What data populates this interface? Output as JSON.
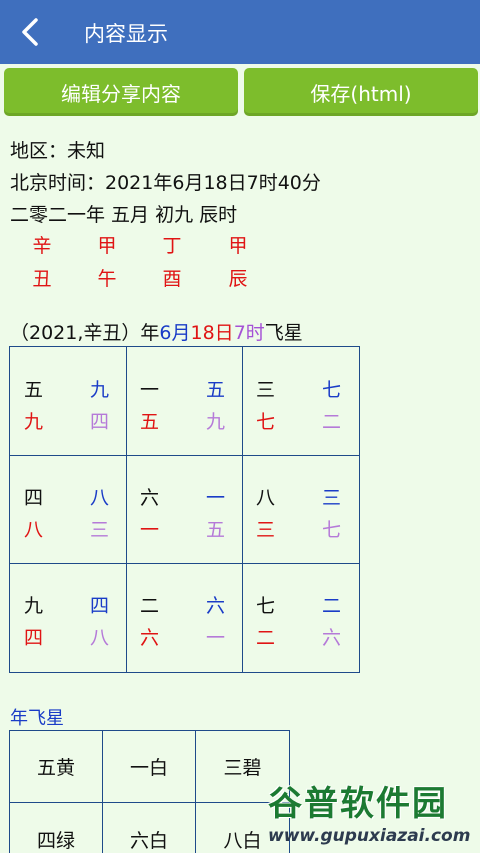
{
  "app_bar": {
    "title": "内容显示",
    "back_icon": "chevron-left-icon"
  },
  "toolbar": {
    "edit_label": "编辑分享内容",
    "save_label": "保存(html)"
  },
  "info": {
    "region": "地区：未知",
    "beijing_time": "北京时间：2021年6月18日7时40分",
    "lunar": "二零二一年 五月 初九 辰时"
  },
  "ganzhi": {
    "stems": [
      "辛",
      "甲",
      "丁",
      "甲"
    ],
    "branches": [
      "丑",
      "午",
      "酉",
      "辰"
    ]
  },
  "flying_star_title": {
    "prefix": "（2021,辛丑）年",
    "month": "6月",
    "day": "18日",
    "hour": "7时",
    "suffix": "飞星"
  },
  "grid": [
    {
      "tl": "五",
      "tr": "九",
      "bl": "九",
      "br": "四"
    },
    {
      "tl": "一",
      "tr": "五",
      "bl": "五",
      "br": "九"
    },
    {
      "tl": "三",
      "tr": "七",
      "bl": "七",
      "br": "二"
    },
    {
      "tl": "四",
      "tr": "八",
      "bl": "八",
      "br": "三"
    },
    {
      "tl": "六",
      "tr": "一",
      "bl": "一",
      "br": "五"
    },
    {
      "tl": "八",
      "tr": "三",
      "bl": "三",
      "br": "七"
    },
    {
      "tl": "九",
      "tr": "四",
      "bl": "四",
      "br": "八"
    },
    {
      "tl": "二",
      "tr": "六",
      "bl": "六",
      "br": "一"
    },
    {
      "tl": "七",
      "tr": "二",
      "bl": "二",
      "br": "六"
    }
  ],
  "year_star": {
    "label": "年飞星",
    "cells": [
      "五黄",
      "一白",
      "三碧",
      "四绿",
      "六白",
      "八白"
    ]
  },
  "watermark": {
    "title": "谷普软件园",
    "url": "www.gupuxiazai.com"
  },
  "colors": {
    "appbar": "#3f6fbe",
    "button": "#7dbd2c",
    "background": "#eefbe9",
    "blue": "#1a3cc7",
    "red": "#e01414",
    "purple": "#a552d6"
  }
}
